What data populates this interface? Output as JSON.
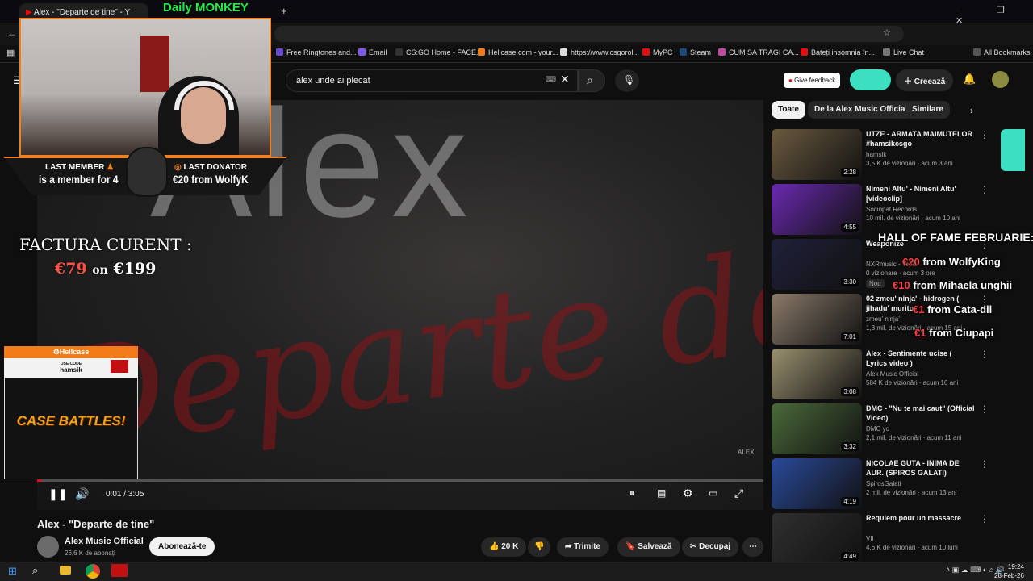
{
  "browser": {
    "tab_title": "Alex - \"Departe de tine\" - Y",
    "bookmarks": [
      "Free Ringtones and...",
      "Email",
      "CS:GO Home - FACE...",
      "Hellcase.com - your...",
      "https://www.csgorol...",
      "MyPC",
      "Steam",
      "CUM SA TRAGI CA...",
      "Bateți insomnia în...",
      "Live Chat",
      "All Bookmarks"
    ]
  },
  "youtube": {
    "search_value": "alex unde ai plecat",
    "feedback_label": "Give feedback",
    "create_label": "Creează",
    "video_word": "Alex",
    "video_script": "Departe de",
    "time": "0:01 / 3:05",
    "progress": 0.005,
    "title": "Alex - \"Departe de tine\"",
    "channel": "Alex Music Official",
    "subscribers": "26,6 K de abonați",
    "subscribe_label": "Abonează-te",
    "likes": "20 K",
    "share_label": "Trimite",
    "save_label": "Salvează",
    "clip_label": "Decupaj",
    "chips": [
      "Toate",
      "De la Alex Music Official",
      "Similare"
    ],
    "related": [
      {
        "title": "UTZE - ARMATA MAIMUTELOR #hamsikcsgo",
        "channel": "hamsik",
        "meta": "3,5 K de vizionări · acum 3 ani",
        "duration": "2:28",
        "color": "#6a5a40"
      },
      {
        "title": "Nimeni Altu' - Nimeni Altu' [videoclip]",
        "channel": "Sociopat Records",
        "meta": "10 mil. de vizionări · acum 10 ani",
        "duration": "4:55",
        "color": "#6a2ab0"
      },
      {
        "title": "Weaponize",
        "channel": "NXRmusic - Topic",
        "meta": "0 vizionare · acum 3 ore",
        "duration": "3:30",
        "badge": "Nou",
        "color": "#20203a"
      },
      {
        "title": "02 zmeu' ninja' - hidrogen ( jihadu' murito",
        "channel": "zmeu' ninja'",
        "meta": "1,3 mil. de vizionări · acum 15 ani",
        "duration": "7:01",
        "color": "#8a7a6a"
      },
      {
        "title": "Alex - Sentimente ucise ( Lyrics video )",
        "channel": "Alex Music Official",
        "meta": "584 K de vizionări · acum 10 ani",
        "duration": "3:08",
        "color": "#9a9070"
      },
      {
        "title": "DMC - \"Nu te mai caut\" (Official Video)",
        "channel": "DMC yo",
        "meta": "2,1 mil. de vizionări · acum 11 ani",
        "duration": "3:32",
        "color": "#4a6a3a"
      },
      {
        "title": "NICOLAE GUTA - INIMA DE AUR. (SPIROS GALATI)",
        "channel": "SpirosGalati",
        "meta": "2 mil. de vizionări · acum 13 ani",
        "duration": "4:19",
        "color": "#2a4a9a"
      },
      {
        "title": "Requiem pour un massacre",
        "channel": "VII",
        "meta": "4,6 K de vizionări · acum 10 luni",
        "duration": "4:49",
        "color": "#303030"
      }
    ]
  },
  "overlay": {
    "daily_monkey": "Daily MONKEY",
    "last_member_label": "LAST MEMBER",
    "last_member_value": "is a member for 4",
    "last_donator_label": "LAST DONATOR",
    "last_donator_value": "€20 from WolfyK",
    "factura_label": "FACTURA CURENT :",
    "factura_current": "€79",
    "factura_on": "on",
    "factura_total": "€199",
    "hellcase_brand": "Hellcase",
    "use_code_label": "USE CODE",
    "use_code_value": "hamsik",
    "case_battles": "CASE BATTLES!",
    "hof_title": "HALL OF FAME FEBRUARIE:",
    "hof": [
      {
        "amount": "€20",
        "text": "from WolfyKing"
      },
      {
        "amount": "€10",
        "text": "from Mihaela unghii"
      },
      {
        "amount": "€1",
        "text": "from Cata-dll"
      },
      {
        "amount": "€1",
        "text": "from Ciupapi"
      }
    ]
  },
  "taskbar": {
    "time": "19:24",
    "date": "28-Feb-26"
  },
  "colors": {
    "accent_orange": "#f08020",
    "monkey_green": "#1ef04a",
    "yt_red": "#ff0000",
    "teal": "#3ce0c0"
  }
}
